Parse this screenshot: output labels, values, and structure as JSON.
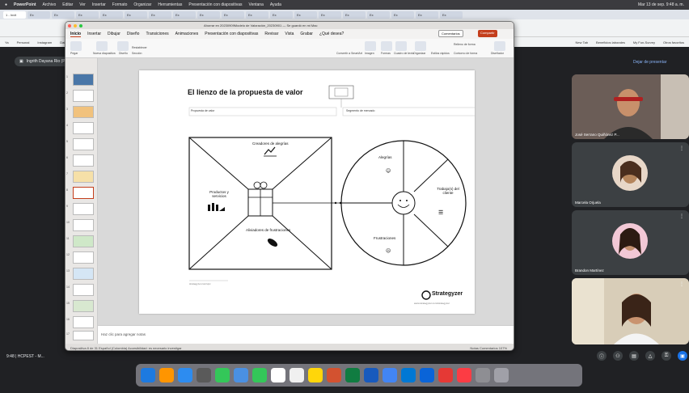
{
  "menubar": {
    "app": "PowerPoint",
    "items": [
      "Archivo",
      "Editar",
      "Ver",
      "Insertar",
      "Formato",
      "Organizar",
      "Herramientas",
      "Presentación con diapositivas",
      "Ventana",
      "Ayuda"
    ],
    "clock": "Mar 13 de sep. 9:48 a. m."
  },
  "chrome": {
    "tabs": [
      "1 - Invit",
      "Ex",
      "Ex",
      "Ex",
      "Ex",
      "Ex",
      "Ex",
      "Ex",
      "Ex",
      "Ex",
      "Ex",
      "Ex",
      "Ex",
      "Ex",
      "Ex",
      "Ex",
      "Ex",
      "Ex",
      "Ex"
    ]
  },
  "bookmarks": [
    "Ya",
    "Personal",
    "Instagram",
    "Daily Anim",
    "Reg Quotes",
    "Trabajo",
    "New Tab",
    "Beneficios laborales",
    "My Fun-Survey",
    "Otros favoritos"
  ],
  "meet": {
    "presenter_chip": "Ingrith Dayana Rio (Presentando)",
    "stop_presenting": "Dejar de presentar",
    "clock": "9:48 | HCPEST - M..."
  },
  "ppt": {
    "doc_title": "Ahorrar en 20230909Modelo de Valoración_20230901 — Se guardó en mi Mac",
    "tabs": [
      "Inicio",
      "Insertar",
      "Dibujar",
      "Diseño",
      "Transiciones",
      "Animaciones",
      "Presentación con diapositivas",
      "Revisar",
      "Vista",
      "Grabar",
      "¿Qué desea?"
    ],
    "comments": "Comentarios",
    "share": "Compartir",
    "ribbon": [
      "Pegar",
      "Nueva diapositiva",
      "Diseño",
      "Restablecer",
      "Sección",
      "Convertir a SmartArt",
      "Imagen",
      "Formas",
      "Cuadro de texto",
      "Organizar",
      "Estilos rápidos",
      "Relleno de forma",
      "Contorno de forma",
      "Diseñador"
    ],
    "thumb_numbers": [
      "1",
      "2",
      "3",
      "4",
      "5",
      "6",
      "7",
      "8",
      "9",
      "10",
      "11",
      "12",
      "13",
      "14",
      "15",
      "16",
      "17"
    ],
    "notes_placeholder": "Haz clic para agregar notas",
    "status": "Diapositiva 8 de 31   Español (Colombia)   Accesibilidad: es necesario investigar",
    "status_right": "Notas   Comentarios   107%"
  },
  "slide": {
    "title": "El lienzo de la propuesta de valor",
    "left_field": "Propuesta de valor",
    "right_field": "Segmento de mercado",
    "gain_creators": "Creadores de alegrías",
    "products": "Productos y servicios",
    "pain_relievers": "Aliviadores de frustraciones",
    "gains": "Alegrías",
    "jobs": "Trabajo(s) del cliente",
    "pains": "Frustraciones",
    "brand": "Strategyzer",
    "footer_left": "strategyzer.com/vpc",
    "footer_right": "www.strategyzer.com/strategyzer"
  },
  "participants": [
    {
      "name": "José Serrano Quiñónez P..."
    },
    {
      "name": "Marcela Orjuela"
    },
    {
      "name": "Brandon Martínez"
    },
    {
      "name": ""
    }
  ]
}
